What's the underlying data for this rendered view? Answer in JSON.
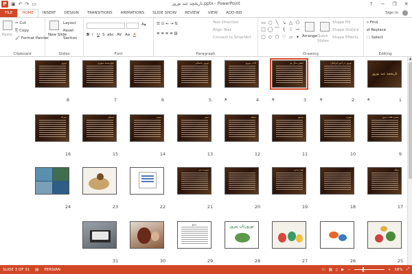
{
  "window": {
    "title": "تاریخچه عید نوروز.pptx - PowerPoint",
    "minimize": "−",
    "restore": "❐",
    "close": "✕",
    "help": "?"
  },
  "tabs": [
    {
      "label": "FILE"
    },
    {
      "label": "HOME"
    },
    {
      "label": "INSERT"
    },
    {
      "label": "DESIGN"
    },
    {
      "label": "TRANSITIONS"
    },
    {
      "label": "ANIMATIONS"
    },
    {
      "label": "SLIDE SHOW"
    },
    {
      "label": "REVIEW"
    },
    {
      "label": "VIEW"
    },
    {
      "label": "ADD-INS"
    }
  ],
  "signin": "Sign in",
  "ribbon": {
    "clipboard": {
      "label": "Clipboard",
      "paste": "Paste",
      "cut": "Cut",
      "copy": "Copy",
      "format_painter": "Format Painter"
    },
    "slides": {
      "label": "Slides",
      "new_slide": "New Slide",
      "layout": "Layout",
      "reset": "Reset",
      "section": "Section"
    },
    "font": {
      "label": "Font",
      "bold": "B",
      "italic": "I",
      "underline": "U",
      "strike": "S",
      "shadow": "abc",
      "spacing": "AV",
      "case": "Aa",
      "color": "A"
    },
    "paragraph": {
      "label": "Paragraph",
      "text_direction": "Text Direction",
      "align_text": "Align Text",
      "smartart": "Convert to SmartArt"
    },
    "drawing": {
      "label": "Drawing",
      "arrange": "Arrange",
      "quick_styles": "Quick Styles",
      "shape_fill": "Shape Fill",
      "shape_outline": "Shape Outline",
      "shape_effects": "Shape Effects"
    },
    "editing": {
      "label": "Editing",
      "find": "Find",
      "replace": "Replace",
      "select": "Select"
    }
  },
  "slides": [
    {
      "number": "1",
      "style": "dark",
      "title": "تاریخچه عید نوروز",
      "has_star": true,
      "kind": "titleonly"
    },
    {
      "number": "2",
      "style": "dark",
      "title": "نوروز در آیین ایرانیان",
      "has_star": true
    },
    {
      "number": "3",
      "style": "dark",
      "title": "جشن سال نو",
      "has_star": true,
      "selected": true
    },
    {
      "number": "4",
      "style": "dark",
      "title": "آداب نوروز",
      "has_star": true
    },
    {
      "number": "5",
      "style": "dark",
      "title": "نوروز باستانی",
      "has_star": false
    },
    {
      "number": "6",
      "style": "dark",
      "title": "",
      "has_star": false
    },
    {
      "number": "7",
      "style": "dark",
      "title": "چهارشنبه سوری",
      "has_star": false
    },
    {
      "number": "8",
      "style": "dark",
      "title": "نوروز",
      "has_star": false
    },
    {
      "number": "9",
      "style": "dark",
      "title": "سفره هفت سین",
      "has_star": false
    },
    {
      "number": "10",
      "style": "dark",
      "title": "سبزه",
      "has_star": false
    },
    {
      "number": "11",
      "style": "dark",
      "title": "سمنو",
      "has_star": false
    },
    {
      "number": "12",
      "style": "dark",
      "title": "سنجد",
      "has_star": false
    },
    {
      "number": "13",
      "style": "dark",
      "title": "سیر",
      "has_star": false
    },
    {
      "number": "14",
      "style": "dark",
      "title": "سیب",
      "has_star": false
    },
    {
      "number": "15",
      "style": "dark",
      "title": "سماق",
      "has_star": false
    },
    {
      "number": "16",
      "style": "dark",
      "title": "سرکه",
      "has_star": false
    },
    {
      "number": "17",
      "style": "dark",
      "title": "سکه",
      "has_star": false
    },
    {
      "number": "18",
      "style": "dark",
      "title": "",
      "has_star": false
    },
    {
      "number": "19",
      "style": "dark",
      "title": "عید دیدنی",
      "has_star": false
    },
    {
      "number": "20",
      "style": "dark",
      "title": "",
      "has_star": false
    },
    {
      "number": "21",
      "style": "dark",
      "title": "سیزده بدر",
      "has_star": false
    },
    {
      "number": "22",
      "style": "white",
      "title": "",
      "has_star": false,
      "kind": "card"
    },
    {
      "number": "23",
      "style": "light",
      "title": "",
      "has_star": false,
      "kind": "table-photo"
    },
    {
      "number": "24",
      "style": "photo-grid",
      "title": "",
      "has_star": false,
      "kind": "photos"
    },
    {
      "number": "25",
      "style": "light",
      "title": "",
      "has_star": false,
      "kind": "haftsin"
    },
    {
      "number": "26",
      "style": "white",
      "title": "",
      "has_star": false,
      "kind": "fish"
    },
    {
      "number": "27",
      "style": "light",
      "title": "",
      "has_star": false,
      "kind": "eggs"
    },
    {
      "number": "28",
      "style": "white",
      "title": "نوروزتان پیروز",
      "has_star": false,
      "kind": "calligraphy"
    },
    {
      "number": "29",
      "style": "white",
      "title": "منابع",
      "has_star": false,
      "kind": "textcard"
    },
    {
      "number": "30",
      "style": "ink",
      "title": "",
      "has_star": false,
      "kind": "art"
    },
    {
      "number": "31",
      "style": "laptop",
      "title": "",
      "has_star": false,
      "kind": "laptop"
    }
  ],
  "status": {
    "slide_info": "SLIDE 3 OF 31",
    "language": "PERSIAN",
    "zoom": "58%",
    "zoom_fraction": 0.58
  }
}
